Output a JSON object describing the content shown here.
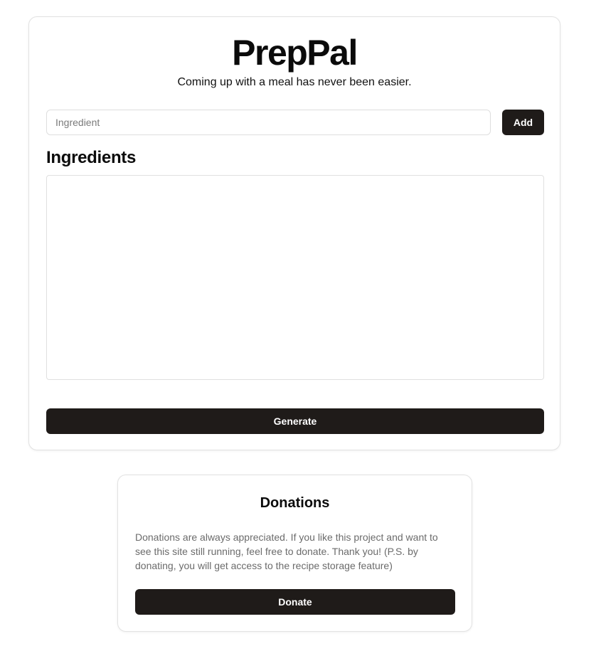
{
  "header": {
    "title": "PrepPal",
    "subtitle": "Coming up with a meal has never been easier."
  },
  "ingredient_form": {
    "input_placeholder": "Ingredient",
    "input_value": "",
    "add_label": "Add"
  },
  "ingredients": {
    "heading": "Ingredients",
    "items": []
  },
  "actions": {
    "generate_label": "Generate"
  },
  "donations": {
    "heading": "Donations",
    "text": "Donations are always appreciated. If you like this project and want to see this site still running, feel free to donate. Thank you! (P.S. by donating, you will get access to the recipe storage feature)",
    "donate_label": "Donate"
  },
  "colors": {
    "button_bg": "#1f1b19",
    "button_text": "#ffffff",
    "border": "#e2e2e2",
    "muted_text": "#6b6b6b"
  }
}
